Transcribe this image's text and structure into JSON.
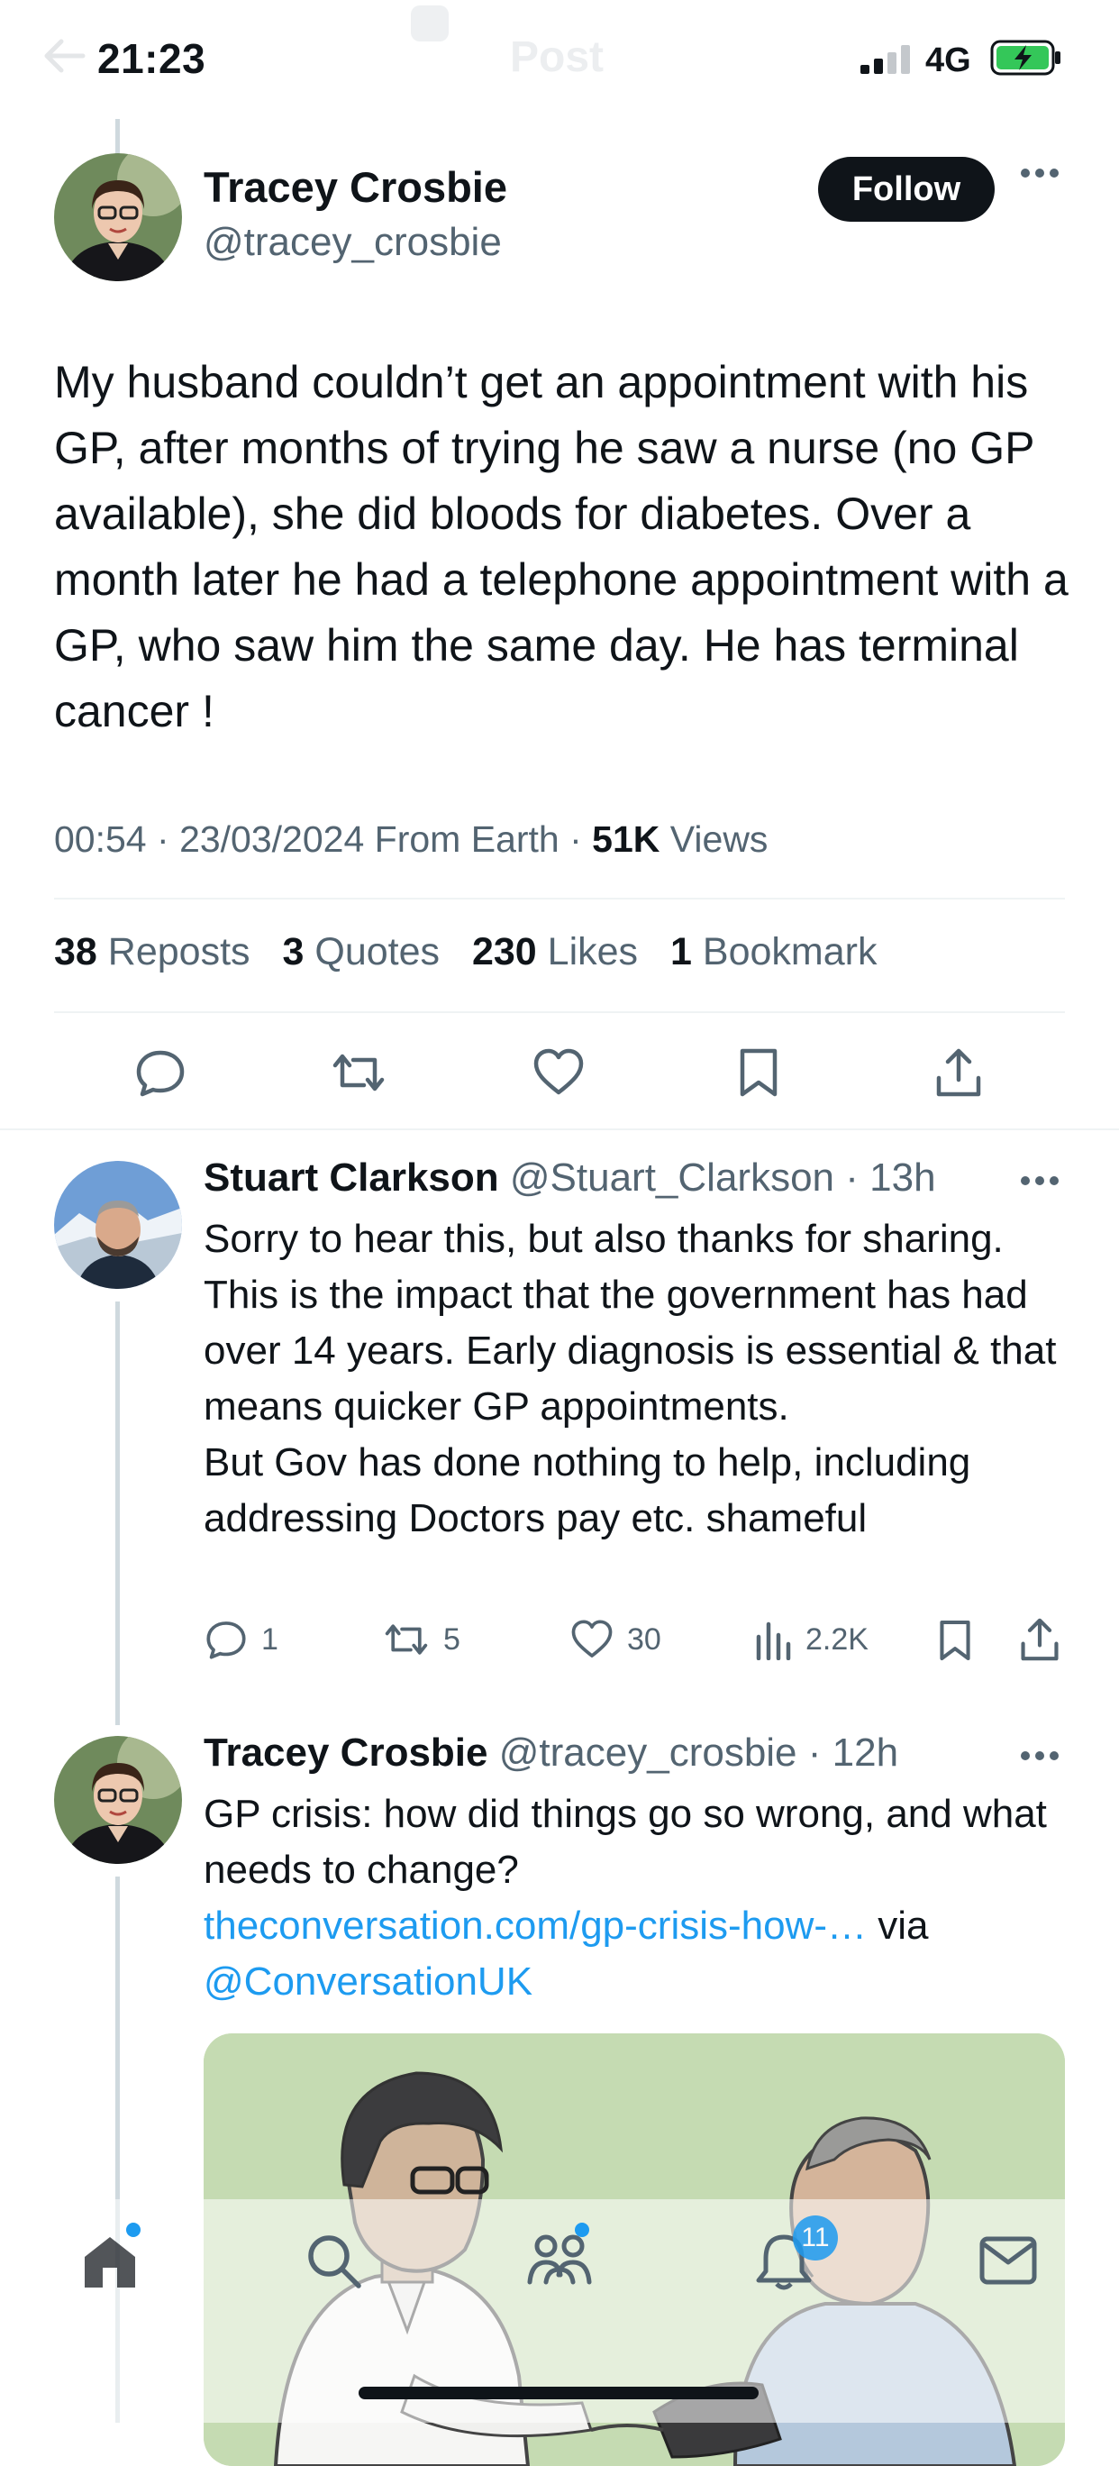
{
  "status": {
    "time": "21:23",
    "network": "4G"
  },
  "header": {
    "title": "Post"
  },
  "main_post": {
    "author_name": "Tracey Crosbie",
    "author_handle": "@tracey_crosbie",
    "follow_label": "Follow",
    "text": "My husband couldn’t get an appointment with his GP, after months of trying he saw a nurse (no GP available), she did bloods for diabetes. Over a month later he had a telephone appointment with a GP, who saw him the same day. He has terminal cancer !",
    "time": "00:54",
    "date": "23/03/2024",
    "source": "From Earth",
    "views_count": "51K",
    "views_label": "Views",
    "stats": {
      "reposts_count": "38",
      "reposts_label": "Reposts",
      "quotes_count": "3",
      "quotes_label": "Quotes",
      "likes_count": "230",
      "likes_label": "Likes",
      "bookmarks_count": "1",
      "bookmarks_label": "Bookmark"
    },
    "actions": [
      "reply-icon",
      "repost-icon",
      "like-icon",
      "bookmark-icon",
      "share-icon"
    ]
  },
  "replies": [
    {
      "author_name": "Stuart Clarkson",
      "author_handle": "@Stuart_Clarkson",
      "age": "13h",
      "text": "Sorry to hear this, but also thanks for sharing. This is the impact that the government has had over 14 years. Early diagnosis is essential & that means quicker GP appointments.\nBut Gov has done nothing to help, including addressing Doctors pay etc. shameful",
      "reply_count": "1",
      "repost_count": "5",
      "like_count": "30",
      "view_count": "2.2K"
    },
    {
      "author_name": "Tracey Crosbie",
      "author_handle": "@tracey_crosbie",
      "age": "12h",
      "text": "GP crisis: how did things go so wrong, and what needs to change?",
      "link_text": "theconversation.com/gp-crisis-how-…",
      "via_label": "via",
      "mention": "@ConversationUK"
    }
  ],
  "bottom_nav": {
    "items": [
      "home-icon",
      "search-icon",
      "communities-icon",
      "notifications-icon",
      "messages-icon"
    ],
    "notifications_count": "11"
  },
  "colors": {
    "accent": "#1d9bf0",
    "text": "#0f1419",
    "secondary": "#536471",
    "divider": "#eff3f4"
  }
}
